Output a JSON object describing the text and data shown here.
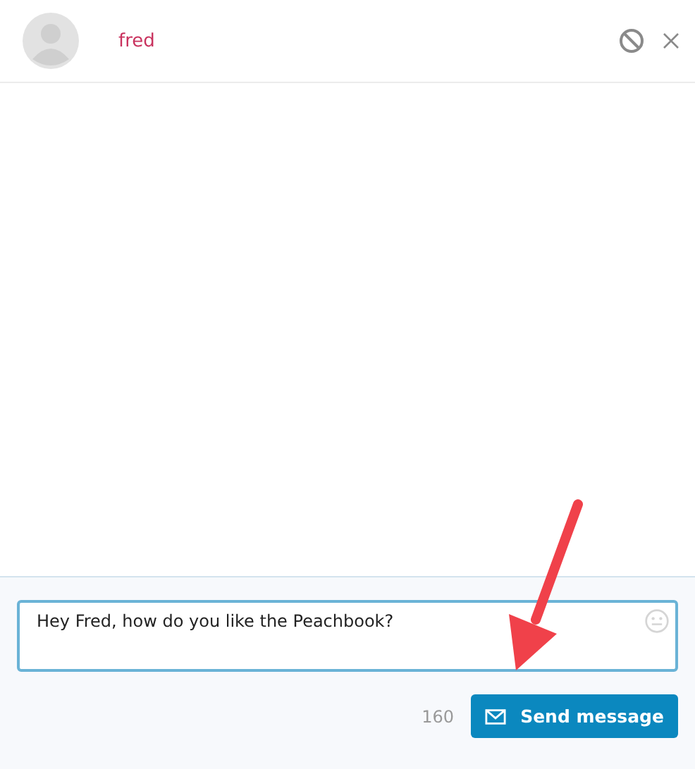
{
  "contact": {
    "name": "fred"
  },
  "composer": {
    "value": "Hey Fred, how do you like the Peachbook?",
    "char_count": "160"
  },
  "send_button": {
    "label": "Send message"
  }
}
